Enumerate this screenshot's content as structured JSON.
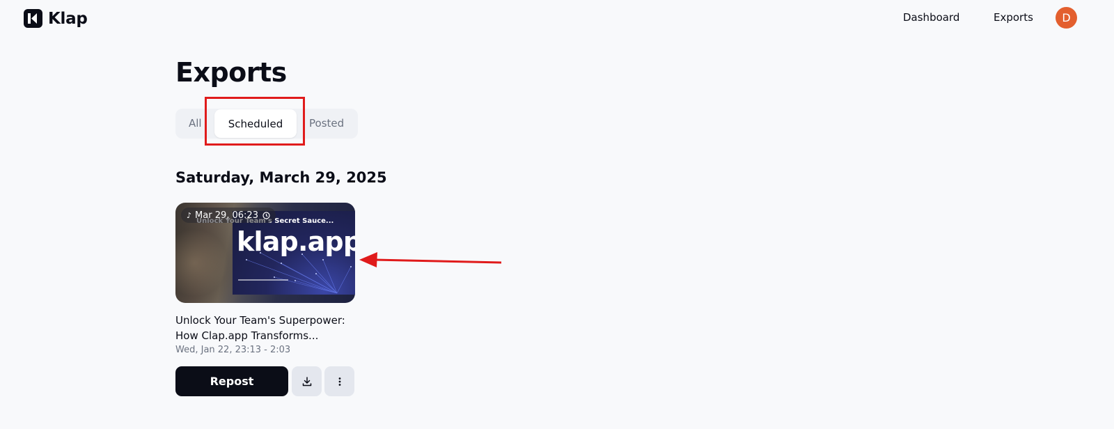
{
  "app": {
    "name": "Klap"
  },
  "nav": {
    "dashboard": "Dashboard",
    "exports": "Exports",
    "avatar_initial": "D"
  },
  "page": {
    "title": "Exports"
  },
  "tabs": {
    "all": "All",
    "scheduled": "Scheduled",
    "posted": "Posted",
    "active": "Scheduled"
  },
  "group": {
    "date": "Saturday, March 29, 2025"
  },
  "card": {
    "scheduled_time": "Mar 29, 06:23",
    "thumb_subtitle": "Unlock Your Team's Secret Sauce...",
    "thumb_brand": "klap.app",
    "title": "Unlock Your Team's Superpower: How Clap.app Transforms...",
    "meta": "Wed, Jan 22, 23:13 - 2:03",
    "repost_label": "Repost",
    "icons": [
      "tiktok-icon",
      "clock-icon",
      "download-icon",
      "more-vertical-icon"
    ]
  },
  "colors": {
    "accent": "#0b0d17",
    "avatar": "#e35f2e",
    "annotation": "#e01b1b"
  }
}
